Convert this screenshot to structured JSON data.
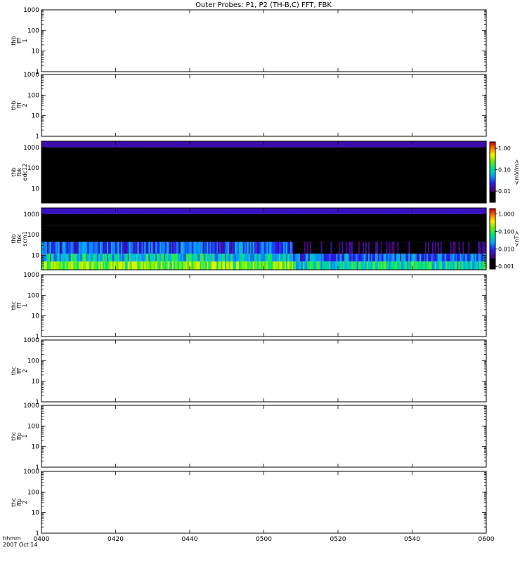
{
  "chart_data": {
    "title": "Outer Probes: P1, P2 (TH-B,C) FFT, FBK",
    "type": "heatmap",
    "x_axis": {
      "range": [
        "0400",
        "0600"
      ],
      "tick_labels": [
        "0400",
        "0420",
        "0440",
        "0500",
        "0520",
        "0540",
        "0600"
      ],
      "row_label": "hhmm",
      "date_label": "2007 Oct 14"
    },
    "panels": [
      {
        "label_lines": [
          "thb",
          "fff",
          "1"
        ],
        "scale": "log",
        "ylim": [
          1,
          1000
        ],
        "y_ticks": [
          "1",
          "10",
          "100",
          "1000"
        ],
        "content": "empty"
      },
      {
        "label_lines": [
          "thb",
          "fff",
          "2"
        ],
        "scale": "log",
        "ylim": [
          1,
          1000
        ],
        "y_ticks": [
          "1",
          "10",
          "100",
          "1000"
        ],
        "content": "empty"
      },
      {
        "label_lines": [
          "thb",
          "fbk",
          "edc12"
        ],
        "scale": "log",
        "ylim": [
          2,
          2000
        ],
        "y_ticks": [
          "10",
          "100",
          "1000"
        ],
        "content": "spectrogram",
        "colorbar": {
          "label": "<mV/m>",
          "ticks": [
            "0.01",
            "0.10",
            "1.00"
          ],
          "range": [
            0.003,
            2.0
          ]
        },
        "bands": [
          {
            "f_low": 1000,
            "f_high": 2000,
            "level": 0.015,
            "variation": "uniform"
          },
          {
            "f_low": 2,
            "f_high": 1000,
            "level": 0.0005,
            "variation": "uniform"
          }
        ]
      },
      {
        "label_lines": [
          "thb",
          "fbk",
          "scm1"
        ],
        "scale": "log",
        "ylim": [
          2,
          2000
        ],
        "y_ticks": [
          "10",
          "100",
          "1000"
        ],
        "content": "spectrogram",
        "colorbar": {
          "label": "<nT>",
          "ticks": [
            "0.001",
            "0.010",
            "0.100",
            "1.000"
          ],
          "range": [
            0.0007,
            2.0
          ]
        },
        "bands": [
          {
            "f_low": 1000,
            "f_high": 2000,
            "level": 0.006,
            "variation": "uniform"
          },
          {
            "f_low": 300,
            "f_high": 1000,
            "level": 0.0009,
            "variation": "streaky"
          },
          {
            "f_low": 150,
            "f_high": 300,
            "level": 0.0006,
            "variation": "dark"
          },
          {
            "f_low": 45,
            "f_high": 150,
            "level": 0.0008,
            "variation": "purple"
          },
          {
            "f_low": 12,
            "f_high": 45,
            "level": 0.012,
            "variation": "streaky"
          },
          {
            "f_low": 5,
            "f_high": 12,
            "level": 0.04,
            "variation": "streaky"
          },
          {
            "f_low": 2,
            "f_high": 5,
            "level": 0.15,
            "variation": "streaky"
          }
        ],
        "transition_time": "0508"
      },
      {
        "label_lines": [
          "thc",
          "fff",
          "1"
        ],
        "scale": "log",
        "ylim": [
          1,
          1000
        ],
        "y_ticks": [
          "1",
          "10",
          "100",
          "1000"
        ],
        "content": "empty"
      },
      {
        "label_lines": [
          "thc",
          "fff",
          "2"
        ],
        "scale": "log",
        "ylim": [
          1,
          1000
        ],
        "y_ticks": [
          "1",
          "10",
          "100",
          "1000"
        ],
        "content": "empty"
      },
      {
        "label_lines": [
          "thc",
          "ffp",
          "1"
        ],
        "scale": "log",
        "ylim": [
          1,
          1000
        ],
        "y_ticks": [
          "1",
          "10",
          "100",
          "1000"
        ],
        "content": "empty"
      },
      {
        "label_lines": [
          "thc",
          "ffp",
          "2"
        ],
        "scale": "log",
        "ylim": [
          1,
          1000
        ],
        "y_ticks": [
          "1",
          "10",
          "100",
          "1000"
        ],
        "content": "empty"
      }
    ]
  }
}
